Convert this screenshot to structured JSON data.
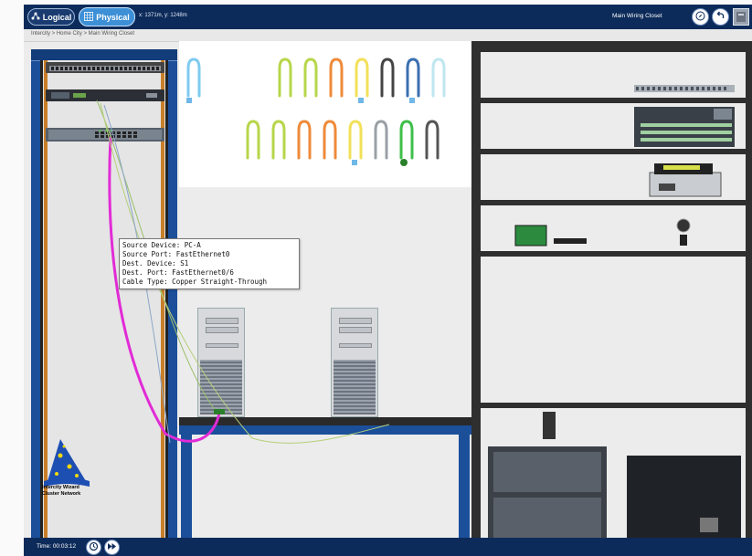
{
  "header": {
    "logical_label": "Logical",
    "physical_label": "Physical",
    "coordinates": "x: 1371m, y: 1248m",
    "location": "Main Wiring Closet",
    "breadcrumb": "Intercity > Home City > Main Wiring Closet"
  },
  "tooltip": {
    "source_device": "Source Device: PC-A",
    "source_port": "Source Port: FastEthernet0",
    "dest_device": "Dest. Device: S1",
    "dest_port": "Dest. Port: FastEthernet0/6",
    "cable_type": "Cable Type: Copper Straight-Through"
  },
  "wizard": {
    "line1": "Intercity Wizard",
    "line2": "Cluster Network"
  },
  "footer": {
    "time": "Time: 00:03:12"
  },
  "colors": {
    "bar": "#0d2b5a",
    "accent": "#3d8fd6",
    "cable_pink": "#e12bd6",
    "rack_blue": "#1b4f9a"
  },
  "icons": [
    "logical-network-icon",
    "physical-grid-icon",
    "navigation-compass-icon",
    "back-arrow-icon",
    "device-panel-icon",
    "reset-clock-icon",
    "fast-forward-icon"
  ]
}
